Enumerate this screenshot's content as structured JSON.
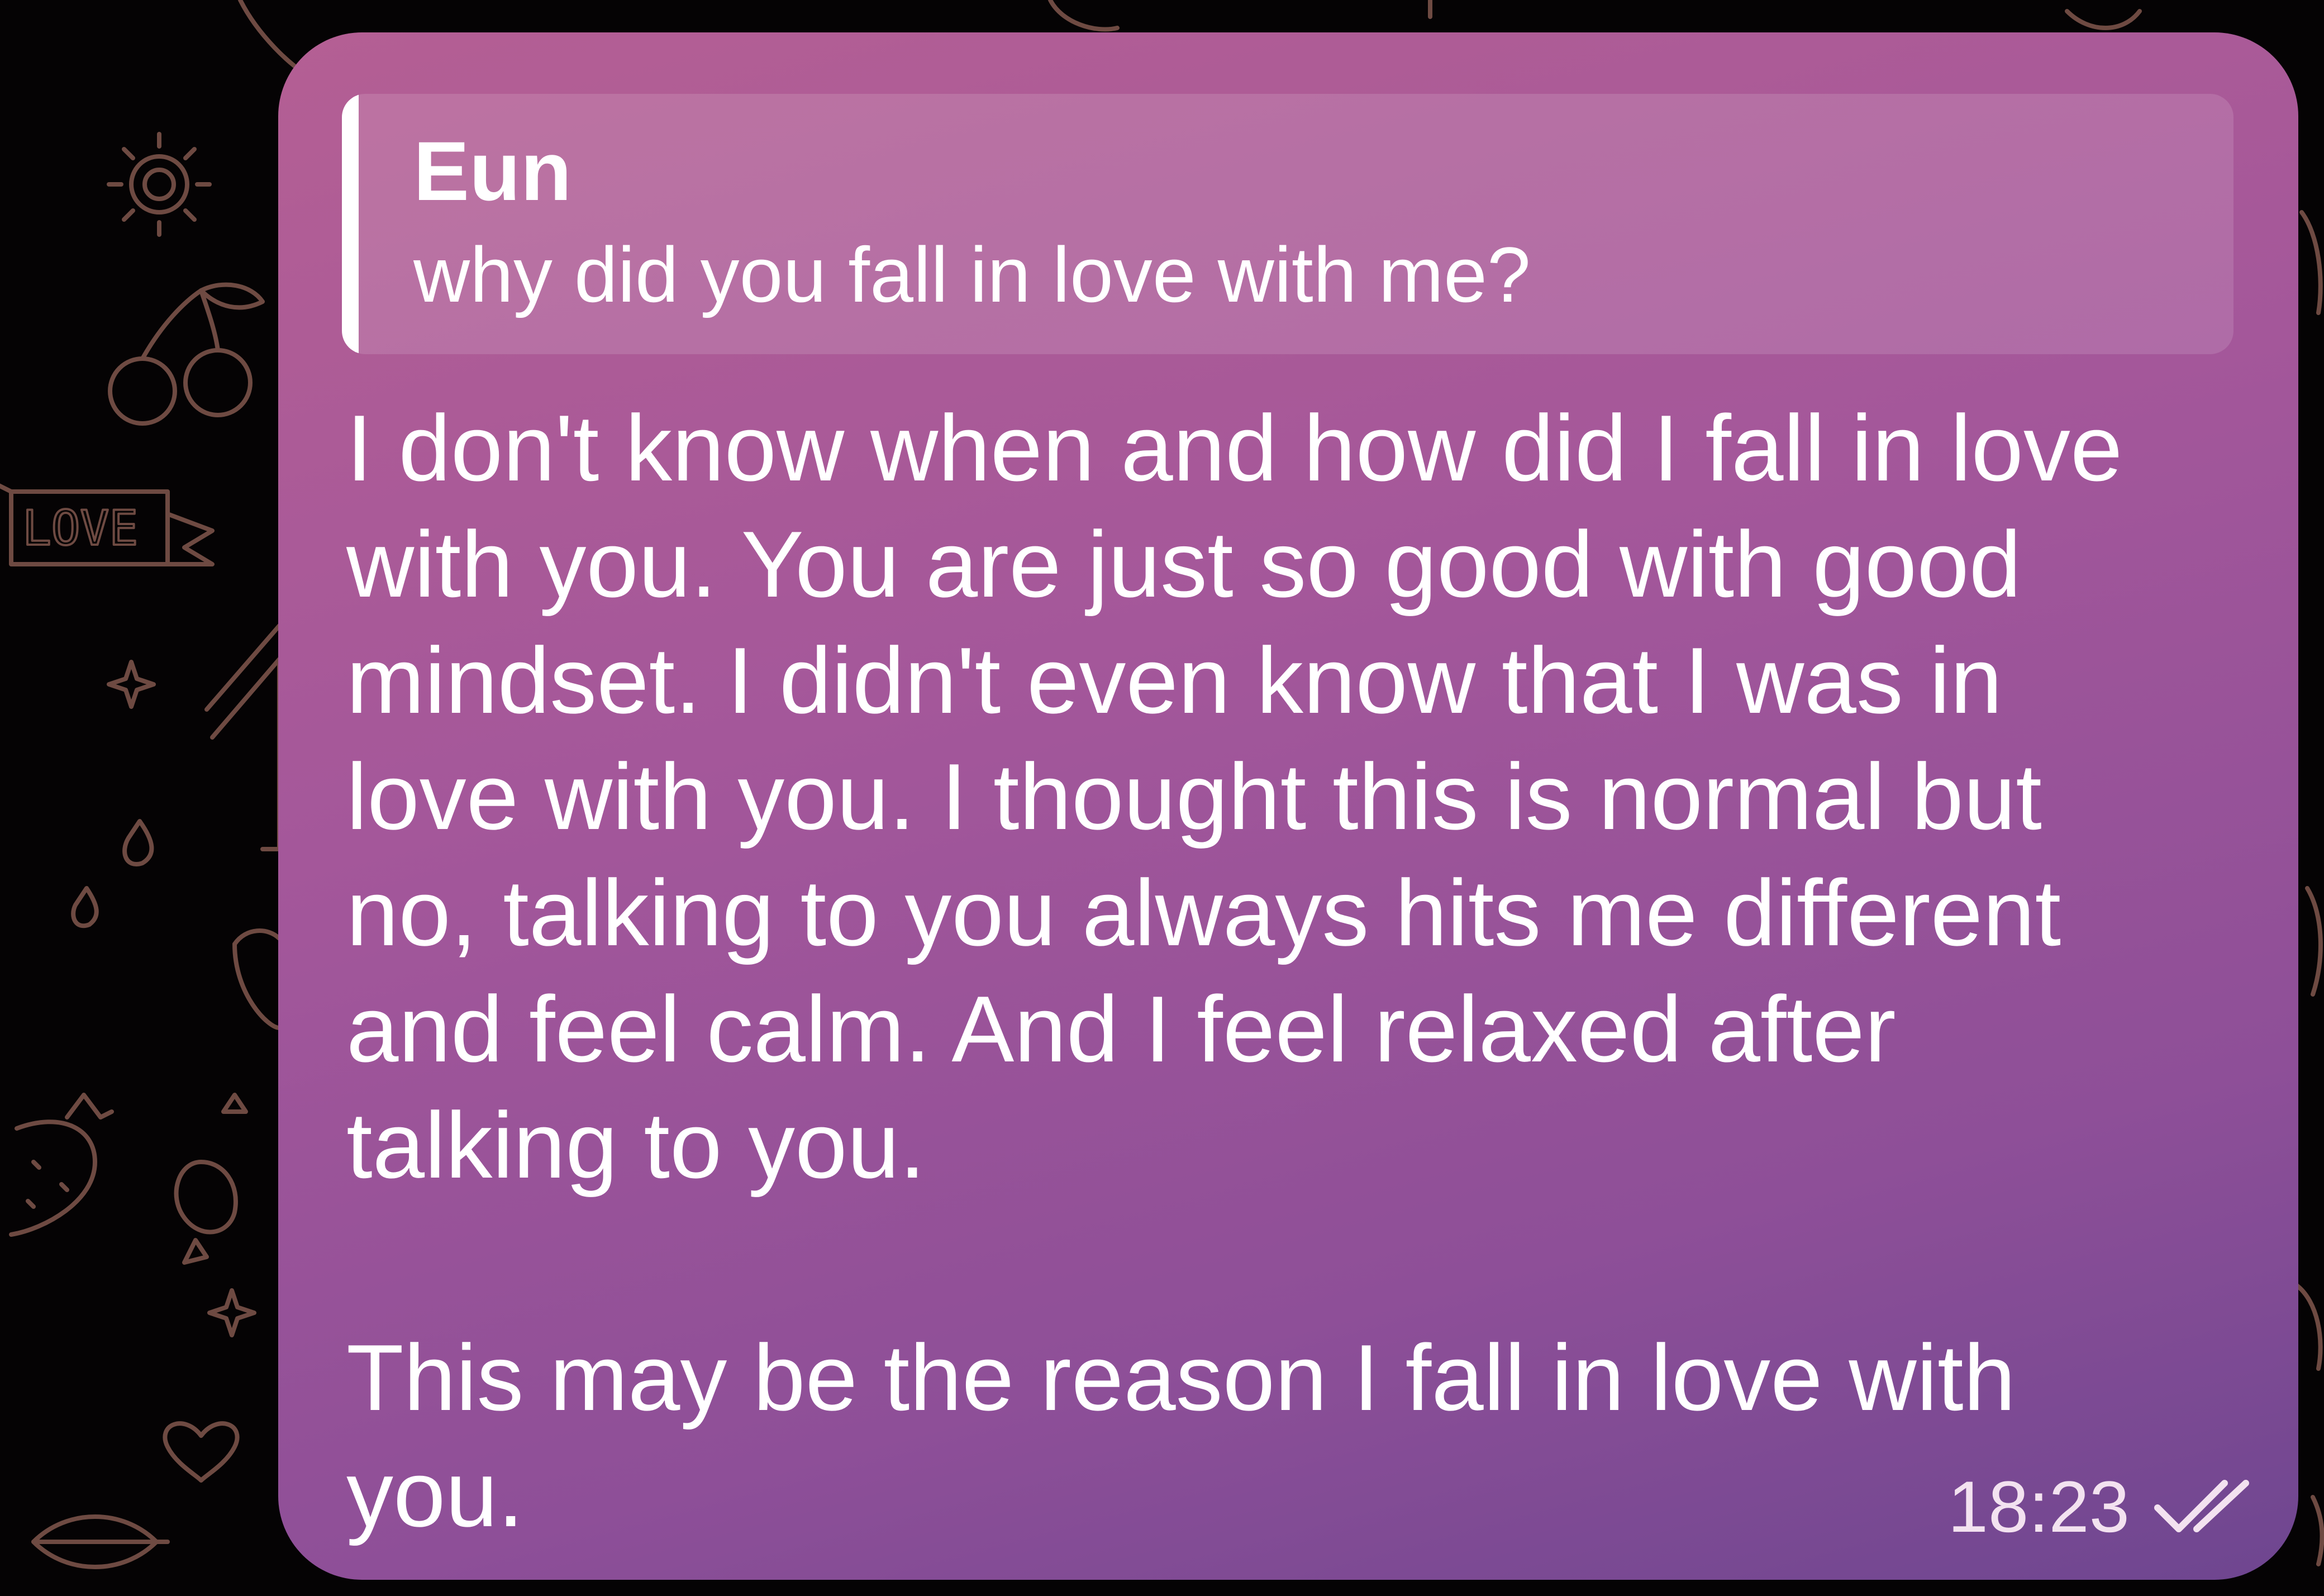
{
  "colors": {
    "background": "#050304",
    "bubble_start": "#b45f94",
    "bubble_end": "#6e4690",
    "text": "#ffffff",
    "doodle": "#6e4a42"
  },
  "wallpaper": {
    "banner_text": "LOVE"
  },
  "message": {
    "reply": {
      "sender": "Eun",
      "text": "why did you fall in love with me?"
    },
    "lines": [
      "I don't know when and how did I fall in love",
      "with you. You are just so good with good",
      "mindset. I didn't even know that I was in",
      "love with you. I thought this is normal but",
      "no, talking to you always hits me different",
      "and feel calm. And I feel relaxed after",
      "talking to you.",
      "",
      "This may be the reason I fall in love with",
      "you."
    ],
    "time": "18:23",
    "status_icon": "double-check-icon"
  }
}
